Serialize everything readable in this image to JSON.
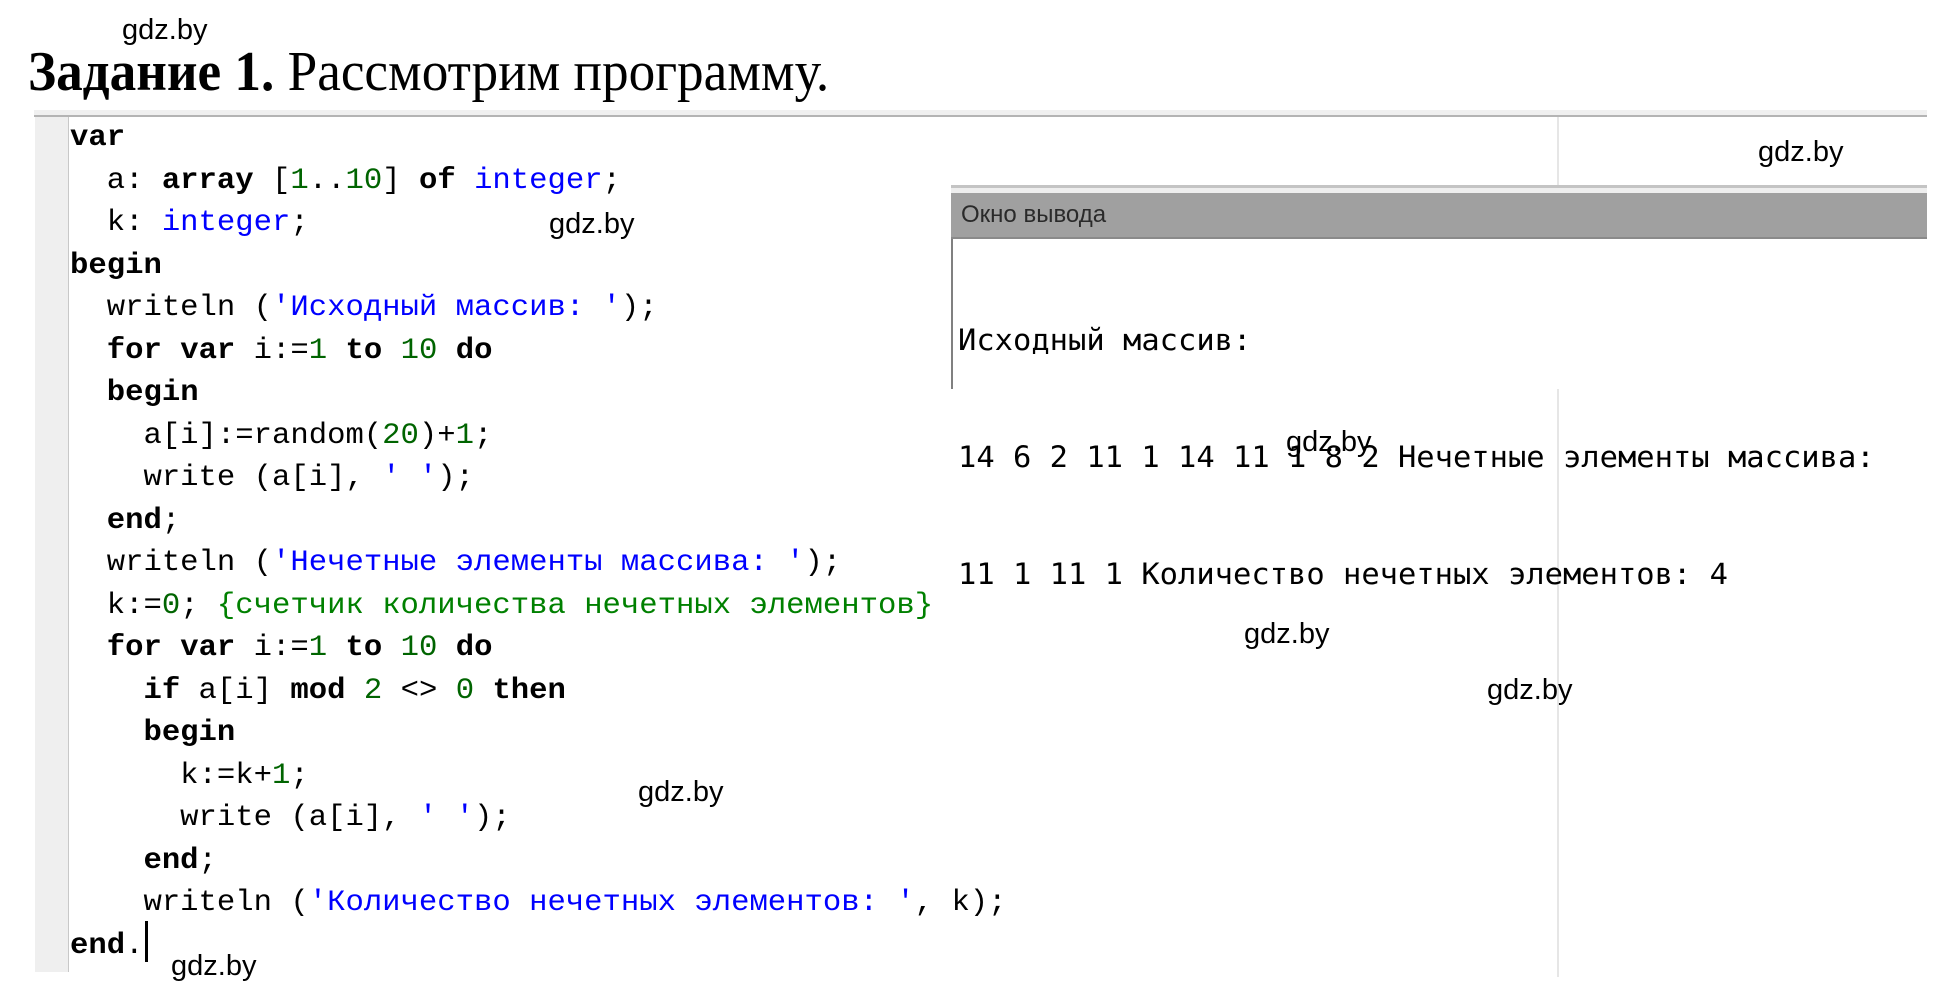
{
  "task_title": {
    "bold": "Задание 1.",
    "regular": " Рассмотрим программу."
  },
  "editor": {
    "lines": [
      [
        {
          "t": "var",
          "c": "kw"
        }
      ],
      [
        {
          "t": "  a: ",
          "c": ""
        },
        {
          "t": "array",
          "c": "kw"
        },
        {
          "t": " [",
          "c": ""
        },
        {
          "t": "1",
          "c": "num"
        },
        {
          "t": "..",
          "c": ""
        },
        {
          "t": "10",
          "c": "num"
        },
        {
          "t": "] ",
          "c": ""
        },
        {
          "t": "of",
          "c": "kw"
        },
        {
          "t": " ",
          "c": ""
        },
        {
          "t": "integer",
          "c": "ty"
        },
        {
          "t": ";",
          "c": ""
        }
      ],
      [
        {
          "t": "  k: ",
          "c": ""
        },
        {
          "t": "integer",
          "c": "ty"
        },
        {
          "t": ";",
          "c": ""
        }
      ],
      [
        {
          "t": "begin",
          "c": "kw"
        }
      ],
      [
        {
          "t": "  writeln (",
          "c": ""
        },
        {
          "t": "'Исходный массив: '",
          "c": "str"
        },
        {
          "t": ");",
          "c": ""
        }
      ],
      [
        {
          "t": "  ",
          "c": ""
        },
        {
          "t": "for",
          "c": "kw"
        },
        {
          "t": " ",
          "c": ""
        },
        {
          "t": "var",
          "c": "kw"
        },
        {
          "t": " i:=",
          "c": ""
        },
        {
          "t": "1",
          "c": "num"
        },
        {
          "t": " ",
          "c": ""
        },
        {
          "t": "to",
          "c": "kw"
        },
        {
          "t": " ",
          "c": ""
        },
        {
          "t": "10",
          "c": "num"
        },
        {
          "t": " ",
          "c": ""
        },
        {
          "t": "do",
          "c": "kw"
        }
      ],
      [
        {
          "t": "  ",
          "c": ""
        },
        {
          "t": "begin",
          "c": "kw"
        }
      ],
      [
        {
          "t": "    a[i]:=random(",
          "c": ""
        },
        {
          "t": "20",
          "c": "num"
        },
        {
          "t": ")+",
          "c": ""
        },
        {
          "t": "1",
          "c": "num"
        },
        {
          "t": ";",
          "c": ""
        }
      ],
      [
        {
          "t": "    write (a[i], ",
          "c": ""
        },
        {
          "t": "' '",
          "c": "str"
        },
        {
          "t": ");",
          "c": ""
        }
      ],
      [
        {
          "t": "  ",
          "c": ""
        },
        {
          "t": "end",
          "c": "kw"
        },
        {
          "t": ";",
          "c": ""
        }
      ],
      [
        {
          "t": "  writeln (",
          "c": ""
        },
        {
          "t": "'Нечетные элементы массива: '",
          "c": "str"
        },
        {
          "t": ");",
          "c": ""
        }
      ],
      [
        {
          "t": "  k:=",
          "c": ""
        },
        {
          "t": "0",
          "c": "num"
        },
        {
          "t": "; ",
          "c": ""
        },
        {
          "t": "{счетчик количества нечетных элементов}",
          "c": "cm"
        }
      ],
      [
        {
          "t": "  ",
          "c": ""
        },
        {
          "t": "for",
          "c": "kw"
        },
        {
          "t": " ",
          "c": ""
        },
        {
          "t": "var",
          "c": "kw"
        },
        {
          "t": " i:=",
          "c": ""
        },
        {
          "t": "1",
          "c": "num"
        },
        {
          "t": " ",
          "c": ""
        },
        {
          "t": "to",
          "c": "kw"
        },
        {
          "t": " ",
          "c": ""
        },
        {
          "t": "10",
          "c": "num"
        },
        {
          "t": " ",
          "c": ""
        },
        {
          "t": "do",
          "c": "kw"
        }
      ],
      [
        {
          "t": "    ",
          "c": ""
        },
        {
          "t": "if",
          "c": "kw"
        },
        {
          "t": " a[i] ",
          "c": ""
        },
        {
          "t": "mod",
          "c": "kw"
        },
        {
          "t": " ",
          "c": ""
        },
        {
          "t": "2",
          "c": "num"
        },
        {
          "t": " <> ",
          "c": ""
        },
        {
          "t": "0",
          "c": "num"
        },
        {
          "t": " ",
          "c": ""
        },
        {
          "t": "then",
          "c": "kw"
        }
      ],
      [
        {
          "t": "    ",
          "c": ""
        },
        {
          "t": "begin",
          "c": "kw"
        }
      ],
      [
        {
          "t": "      k:=k+",
          "c": ""
        },
        {
          "t": "1",
          "c": "num"
        },
        {
          "t": ";",
          "c": ""
        }
      ],
      [
        {
          "t": "      write (a[i], ",
          "c": ""
        },
        {
          "t": "' '",
          "c": "str"
        },
        {
          "t": ");",
          "c": ""
        }
      ],
      [
        {
          "t": "    ",
          "c": ""
        },
        {
          "t": "end",
          "c": "kw"
        },
        {
          "t": ";",
          "c": ""
        }
      ],
      [
        {
          "t": "    writeln (",
          "c": ""
        },
        {
          "t": "'Количество нечетных элементов: '",
          "c": "str"
        },
        {
          "t": ", k);",
          "c": ""
        }
      ],
      [
        {
          "t": "end",
          "c": "kw"
        },
        {
          "t": ".",
          "c": ""
        }
      ]
    ]
  },
  "output_window": {
    "title": "Окно вывода",
    "lines": [
      "Исходный массив:",
      "14 6 2 11 1 14 11 1 8 2 Нечетные элементы массива:",
      "11 1 11 1 Количество нечетных элементов: 4"
    ]
  },
  "watermark": {
    "text": "gdz.by"
  },
  "colors": {
    "keyword": "#000000",
    "type": "#0000ff",
    "number": "#006400",
    "string": "#0000ff",
    "comment": "#008000",
    "output_header": "#a0a0a0"
  }
}
